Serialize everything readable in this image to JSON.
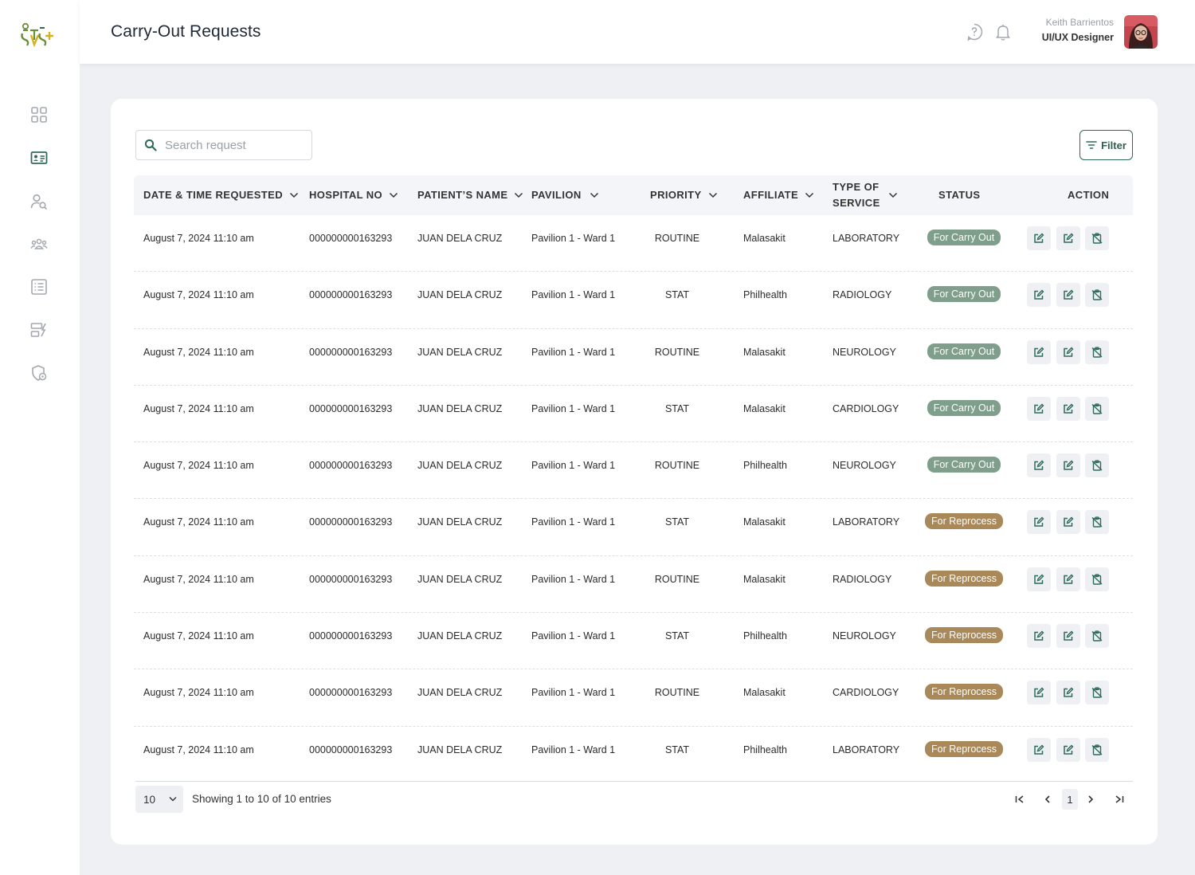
{
  "header": {
    "title": "Carry-Out Requests",
    "user_name": "Keith Barrientos",
    "user_role": "UI/UX Designer"
  },
  "sidebar": {
    "items": [
      {
        "icon": "dashboard-grid-icon",
        "active": false
      },
      {
        "icon": "id-card-icon",
        "active": true
      },
      {
        "icon": "user-search-icon",
        "active": false
      },
      {
        "icon": "group-icon",
        "active": false
      },
      {
        "icon": "list-icon",
        "active": false
      },
      {
        "icon": "cards-edit-icon",
        "active": false
      },
      {
        "icon": "shield-settings-icon",
        "active": false
      }
    ]
  },
  "search": {
    "placeholder": "Search request"
  },
  "filter_label": "Filter",
  "table": {
    "columns": [
      "DATE & TIME REQUESTED",
      "HOSPITAL NO",
      "PATIENT’S NAME",
      "PAVILION",
      "PRIORITY",
      "AFFILIATE",
      "TYPE OF SERVICE",
      "STATUS",
      "ACTION"
    ],
    "rows": [
      {
        "datetime": "August 7, 2024 11:10 am",
        "hospital_no": "000000000163293",
        "patient": "JUAN DELA CRUZ",
        "pavilion": "Pavilion 1 - Ward 1",
        "priority": "ROUTINE",
        "affiliate": "Malasakit",
        "service": "LABORATORY",
        "status": "For Carry Out"
      },
      {
        "datetime": "August 7, 2024 11:10 am",
        "hospital_no": "000000000163293",
        "patient": "JUAN DELA CRUZ",
        "pavilion": "Pavilion 1 - Ward 1",
        "priority": "STAT",
        "affiliate": "Philhealth",
        "service": "RADIOLOGY",
        "status": "For Carry Out"
      },
      {
        "datetime": "August 7, 2024 11:10 am",
        "hospital_no": "000000000163293",
        "patient": "JUAN DELA CRUZ",
        "pavilion": "Pavilion 1 - Ward 1",
        "priority": "ROUTINE",
        "affiliate": "Malasakit",
        "service": "NEUROLOGY",
        "status": "For Carry Out"
      },
      {
        "datetime": "August 7, 2024 11:10 am",
        "hospital_no": "000000000163293",
        "patient": "JUAN DELA CRUZ",
        "pavilion": "Pavilion 1 - Ward 1",
        "priority": "STAT",
        "affiliate": "Malasakit",
        "service": "CARDIOLOGY",
        "status": "For Carry Out"
      },
      {
        "datetime": "August 7, 2024 11:10 am",
        "hospital_no": "000000000163293",
        "patient": "JUAN DELA CRUZ",
        "pavilion": "Pavilion 1 - Ward 1",
        "priority": "ROUTINE",
        "affiliate": "Philhealth",
        "service": "NEUROLOGY",
        "status": "For Carry Out"
      },
      {
        "datetime": "August 7, 2024 11:10 am",
        "hospital_no": "000000000163293",
        "patient": "JUAN DELA CRUZ",
        "pavilion": "Pavilion 1 - Ward 1",
        "priority": "STAT",
        "affiliate": "Malasakit",
        "service": "LABORATORY",
        "status": "For Reprocess"
      },
      {
        "datetime": "August 7, 2024 11:10 am",
        "hospital_no": "000000000163293",
        "patient": "JUAN DELA CRUZ",
        "pavilion": "Pavilion 1 - Ward 1",
        "priority": "ROUTINE",
        "affiliate": "Malasakit",
        "service": "RADIOLOGY",
        "status": "For Reprocess"
      },
      {
        "datetime": "August 7, 2024 11:10 am",
        "hospital_no": "000000000163293",
        "patient": "JUAN DELA CRUZ",
        "pavilion": "Pavilion 1 - Ward 1",
        "priority": "STAT",
        "affiliate": "Philhealth",
        "service": "NEUROLOGY",
        "status": "For Reprocess"
      },
      {
        "datetime": "August 7, 2024 11:10 am",
        "hospital_no": "000000000163293",
        "patient": "JUAN DELA CRUZ",
        "pavilion": "Pavilion 1 - Ward 1",
        "priority": "ROUTINE",
        "affiliate": "Malasakit",
        "service": "CARDIOLOGY",
        "status": "For Reprocess"
      },
      {
        "datetime": "August 7, 2024 11:10 am",
        "hospital_no": "000000000163293",
        "patient": "JUAN DELA CRUZ",
        "pavilion": "Pavilion 1 - Ward 1",
        "priority": "STAT",
        "affiliate": "Philhealth",
        "service": "LABORATORY",
        "status": "For Reprocess"
      }
    ]
  },
  "status_colors": {
    "For Carry Out": "#7f9e8b",
    "For Reprocess": "#a9885a"
  },
  "colors": {
    "accent_green": "#2f6b57",
    "action_icon": "#2f6b57",
    "sidebar_icon": "#a3a8b0"
  },
  "pagination": {
    "page_size": "10",
    "summary": "Showing 1 to 10 of 10 entries",
    "current_page": "1"
  }
}
